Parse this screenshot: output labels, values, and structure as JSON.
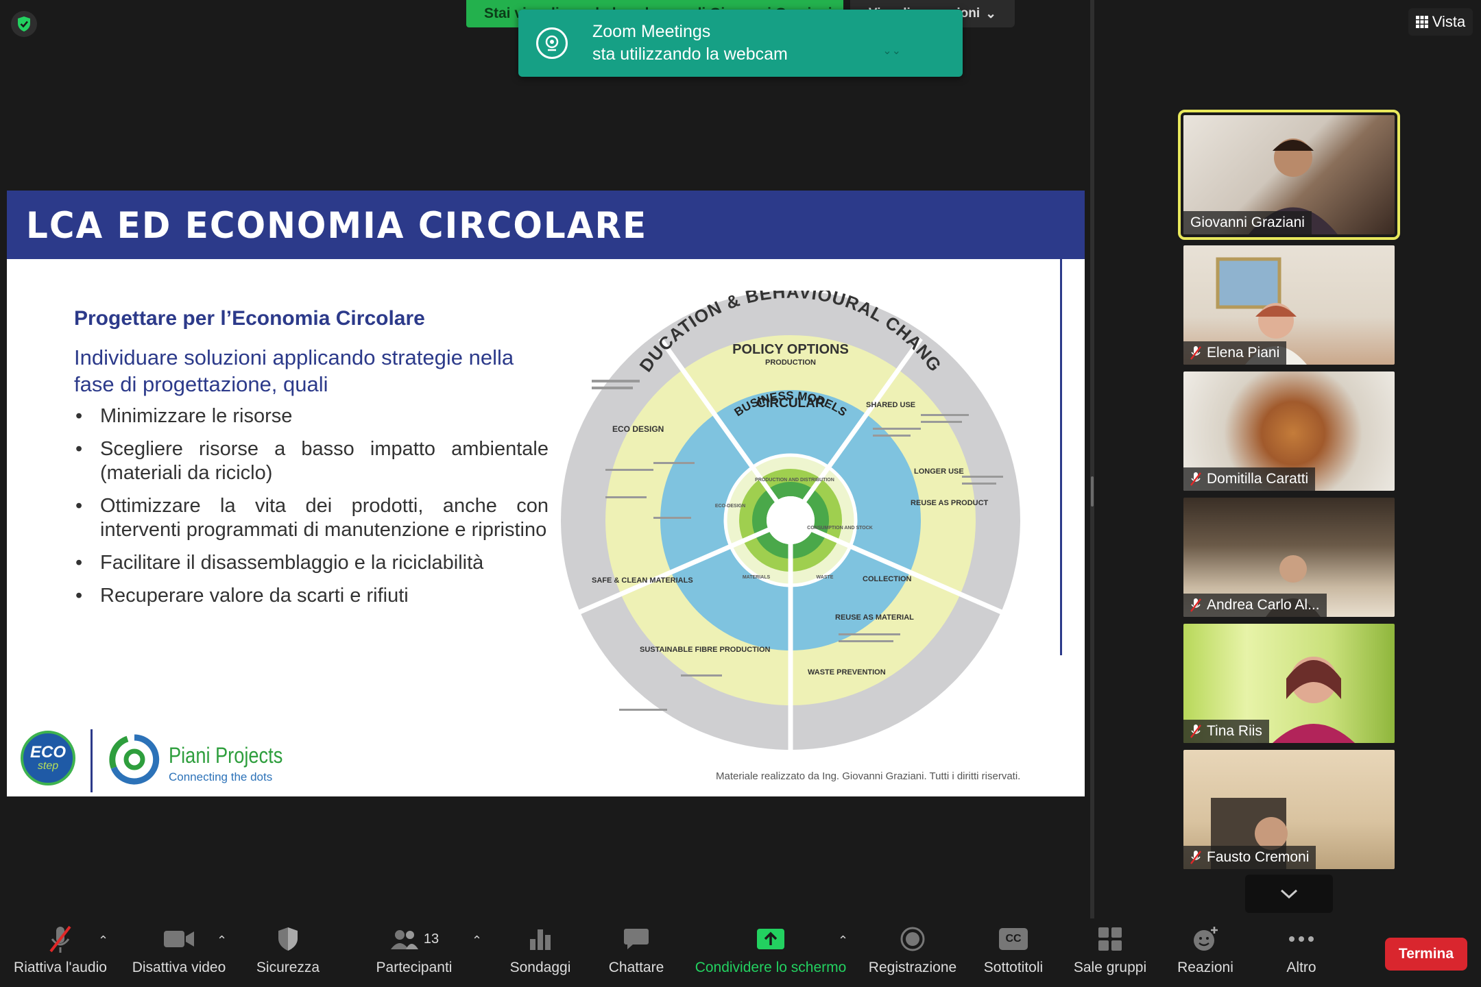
{
  "share_banner": {
    "text": "Stai visualizzando lo schermo di Giovanni Graziani"
  },
  "view_options": {
    "label": "Visualizza opzioni"
  },
  "toast": {
    "app": "Zoom Meetings",
    "message": "sta utilizzando la webcam"
  },
  "view_button": {
    "label": "Vista"
  },
  "slide": {
    "title": "LCA ED ECONOMIA CIRCOLARE",
    "subtitle": "Progettare per l’Economia Circolare",
    "lead": "Individuare soluzioni applicando strategie nella fase di progettazione, quali",
    "bullets": [
      "Minimizzare le risorse",
      "Scegliere risorse a basso impatto ambientale (materiali da riciclo)",
      "Ottimizzare la vita dei prodotti, anche con interventi programmati di manutenzione e ripristino",
      "Facilitare il disassemblaggio e la riciclabilità",
      "Recuperare valore da scarti e rifiuti"
    ],
    "credit": "Materiale realizzato da Ing. Giovanni Graziani. Tutti i diritti riservati.",
    "logo_eco": [
      "ECO",
      "step"
    ],
    "logo_piani_name": "Piani Projects",
    "logo_piani_tag": "Connecting the dots",
    "wheel": {
      "outer_top": "EDUCATION & BEHAVIOURAL CHANGE",
      "policy": "POLICY OPTIONS",
      "production": "PRODUCTION",
      "cbm": [
        "CIRCULAR",
        "BUSINESS MODELS"
      ],
      "eco_design": "ECO DESIGN",
      "shared_use": "SHARED USE",
      "longer_use": "LONGER USE",
      "reuse_product": "REUSE AS PRODUCT",
      "collection": "COLLECTION",
      "reuse_material": "REUSE AS MATERIAL",
      "waste_prevention": "WASTE PREVENTION",
      "safe_clean": "SAFE & CLEAN MATERIALS",
      "sustainable_fibre": "SUSTAINABLE FIBRE PRODUCTION",
      "inner": [
        "PRODUCTION AND DISTRIBUTION",
        "CONSUMPTION AND STOCK",
        "WASTE",
        "MATERIALS",
        "ECO-DESIGN"
      ]
    }
  },
  "participants": [
    {
      "name": "Giovanni Graziani",
      "muted": false,
      "active": true
    },
    {
      "name": "Elena Piani",
      "muted": true,
      "active": false
    },
    {
      "name": "Domitilla Caratti",
      "muted": true,
      "active": false
    },
    {
      "name": "Andrea Carlo Al...",
      "muted": true,
      "active": false
    },
    {
      "name": "Tina Riis",
      "muted": true,
      "active": false
    },
    {
      "name": "Fausto Cremoni",
      "muted": true,
      "active": false
    }
  ],
  "toolbar": {
    "unmute": "Riattiva l'audio",
    "stop_video": "Disattiva video",
    "security": "Sicurezza",
    "participants": "Partecipanti",
    "participants_count": "13",
    "polls": "Sondaggi",
    "chat": "Chattare",
    "share": "Condividere lo schermo",
    "record": "Registrazione",
    "captions": "Sottotitoli",
    "captions_icon_text": "CC",
    "breakout": "Sale gruppi",
    "reactions": "Reazioni",
    "more": "Altro",
    "end": "Termina"
  },
  "colors": {
    "accent_green": "#23d160",
    "slide_blue": "#2c3a8a",
    "toast_teal": "#16a085",
    "end_red": "#d9262e",
    "active_border": "#e8e85c"
  }
}
